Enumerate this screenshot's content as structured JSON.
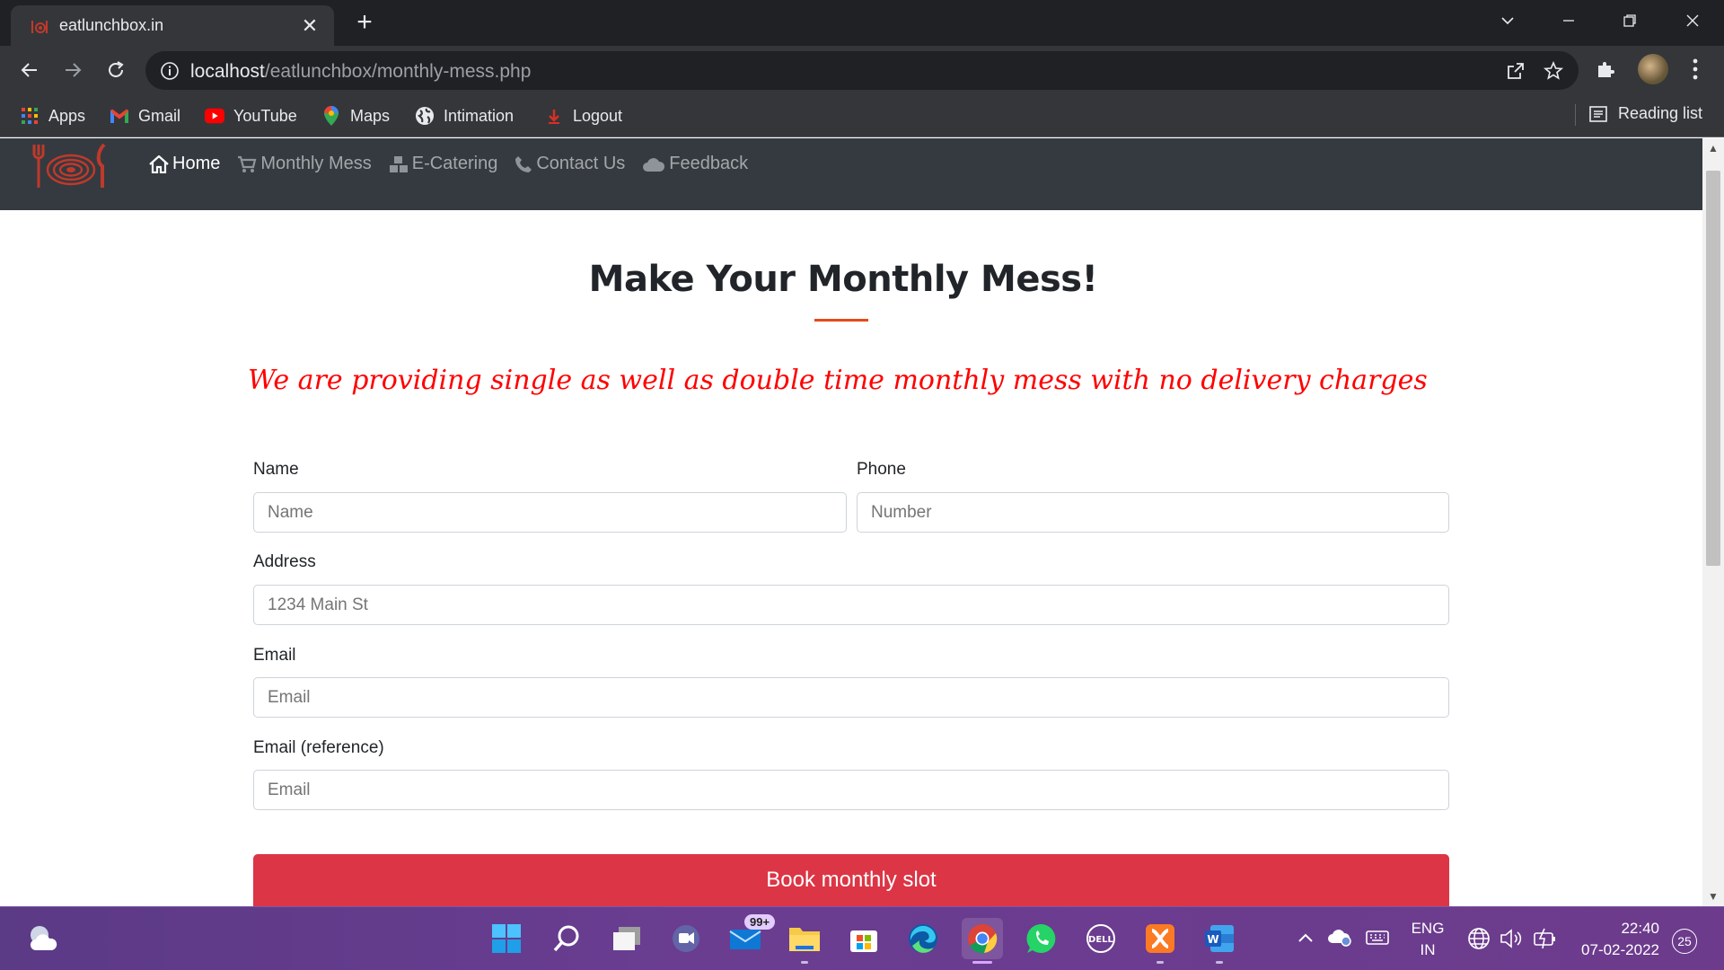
{
  "browser": {
    "tab_title": "eatlunchbox.in",
    "tab_close": "✕",
    "new_tab": "+",
    "url_host": "localhost",
    "url_path": "/eatlunchbox/monthly-mess.php"
  },
  "bookmarks": {
    "items": [
      {
        "label": "Apps",
        "icon": "apps-grid-icon"
      },
      {
        "label": "Gmail",
        "icon": "gmail-icon"
      },
      {
        "label": "YouTube",
        "icon": "youtube-icon"
      },
      {
        "label": "Maps",
        "icon": "maps-pin-icon"
      },
      {
        "label": "Intimation",
        "icon": "globe-icon"
      },
      {
        "label": "Logout",
        "icon": "logout-arrow-icon"
      }
    ],
    "reading_list": "Reading list"
  },
  "nav": {
    "links": [
      {
        "label": "Home",
        "icon": "home-icon"
      },
      {
        "label": "Monthly Mess",
        "icon": "cart-icon"
      },
      {
        "label": "E-Catering",
        "icon": "cubes-icon"
      },
      {
        "label": "Contact Us",
        "icon": "phone-icon"
      },
      {
        "label": "Feedback",
        "icon": "cloud-icon"
      }
    ]
  },
  "page": {
    "title": "Make Your Monthly Mess!",
    "marquee": "We are providing single as well as double time monthly mess with no delivery charges at your do"
  },
  "form": {
    "name_label": "Name",
    "name_placeholder": "Name",
    "phone_label": "Phone",
    "phone_placeholder": "Number",
    "address_label": "Address",
    "address_placeholder": "1234 Main St",
    "email_label": "Email",
    "email_placeholder": "Email",
    "email_ref_label": "Email (reference)",
    "email_ref_placeholder": "Email",
    "submit_label": "Book monthly slot"
  },
  "taskbar": {
    "mail_badge": "99+",
    "language_top": "ENG",
    "language_bottom": "IN",
    "time": "22:40",
    "date": "07-02-2022",
    "notification_count": "25"
  },
  "colors": {
    "brand_red": "#dc3545",
    "navbar_bg": "#343a40",
    "marquee_red": "#ff0000",
    "title_rule": "#e64a19"
  }
}
